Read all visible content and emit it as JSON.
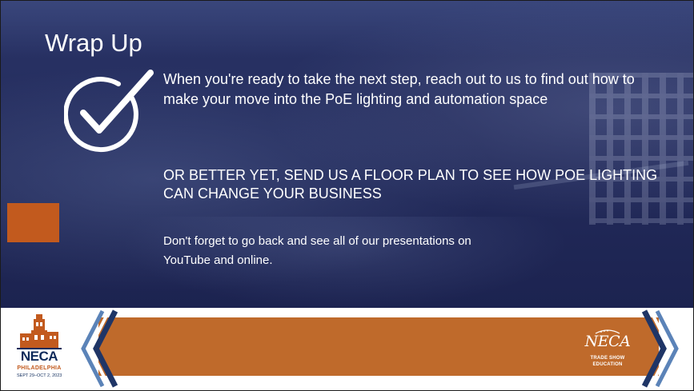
{
  "slide": {
    "title": "Wrap Up",
    "paragraphs": {
      "intro": "When you're ready to take the next step, reach out to us to find out how to make your move into the PoE lighting and automation space",
      "cta": "OR BETTER YET, SEND US A FLOOR PLAN TO SEE HOW POE LIGHTING CAN CHANGE YOUR BUSINESS",
      "reminder": "Don't forget to go back and see all of our presentations on YouTube and online."
    },
    "icons": {
      "check": "checkmark-circle-icon"
    }
  },
  "footer": {
    "left_logo": {
      "brand": "NECA",
      "city": "PHILADELPHIA",
      "dates": "SEPT 29–OCT 2, 2023"
    },
    "right_logo": {
      "brand": "NECA",
      "line1": "TRADE SHOW",
      "line2": "EDUCATION"
    }
  },
  "colors": {
    "background_navy": "#222a5a",
    "accent_orange": "#bf6a2b",
    "chevron_navy": "#1f3566",
    "chevron_blue": "#5b83b8",
    "text_white": "#ffffff"
  }
}
